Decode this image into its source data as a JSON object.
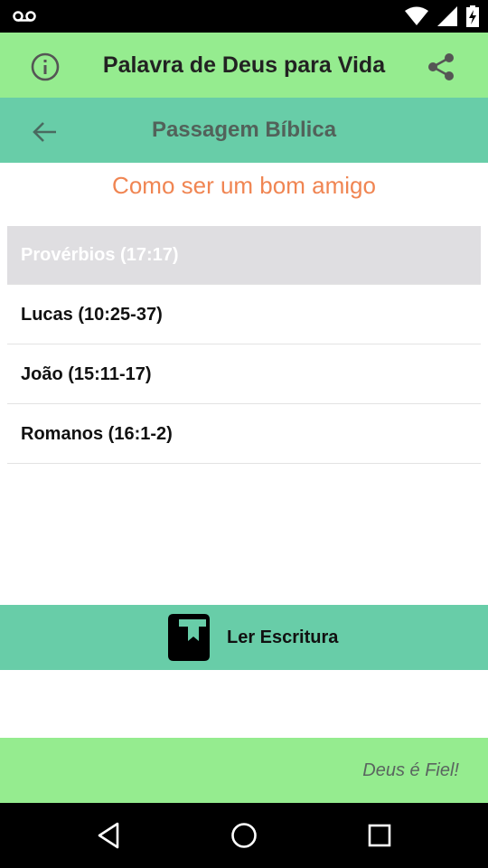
{
  "app_bar": {
    "title": "Palavra de Deus para Vida"
  },
  "sub_bar": {
    "title": "Passagem Bíblica"
  },
  "topic": "Como ser um bom amigo",
  "passages": [
    {
      "label": "Provérbios (17:17)",
      "selected": true
    },
    {
      "label": "Lucas (10:25-37)",
      "selected": false
    },
    {
      "label": "João (15:11-17)",
      "selected": false
    },
    {
      "label": "Romanos (16:1-2)",
      "selected": false
    }
  ],
  "read_button": {
    "label": "Ler Escritura"
  },
  "footer": {
    "text": "Deus é Fiel!"
  },
  "colors": {
    "app_bar": "#95ec8f",
    "sub_bar": "#68cda8",
    "topic": "#f08552",
    "selected_row": "#dfdee1"
  },
  "icons": {
    "status": [
      "voicemail-icon",
      "wifi-icon",
      "signal-icon",
      "battery-icon"
    ],
    "app_bar": [
      "info-icon",
      "share-icon"
    ],
    "sub_bar": [
      "back-arrow-icon"
    ],
    "read_button": "book-icon",
    "nav": [
      "back-triangle-icon",
      "home-circle-icon",
      "recents-square-icon"
    ]
  }
}
